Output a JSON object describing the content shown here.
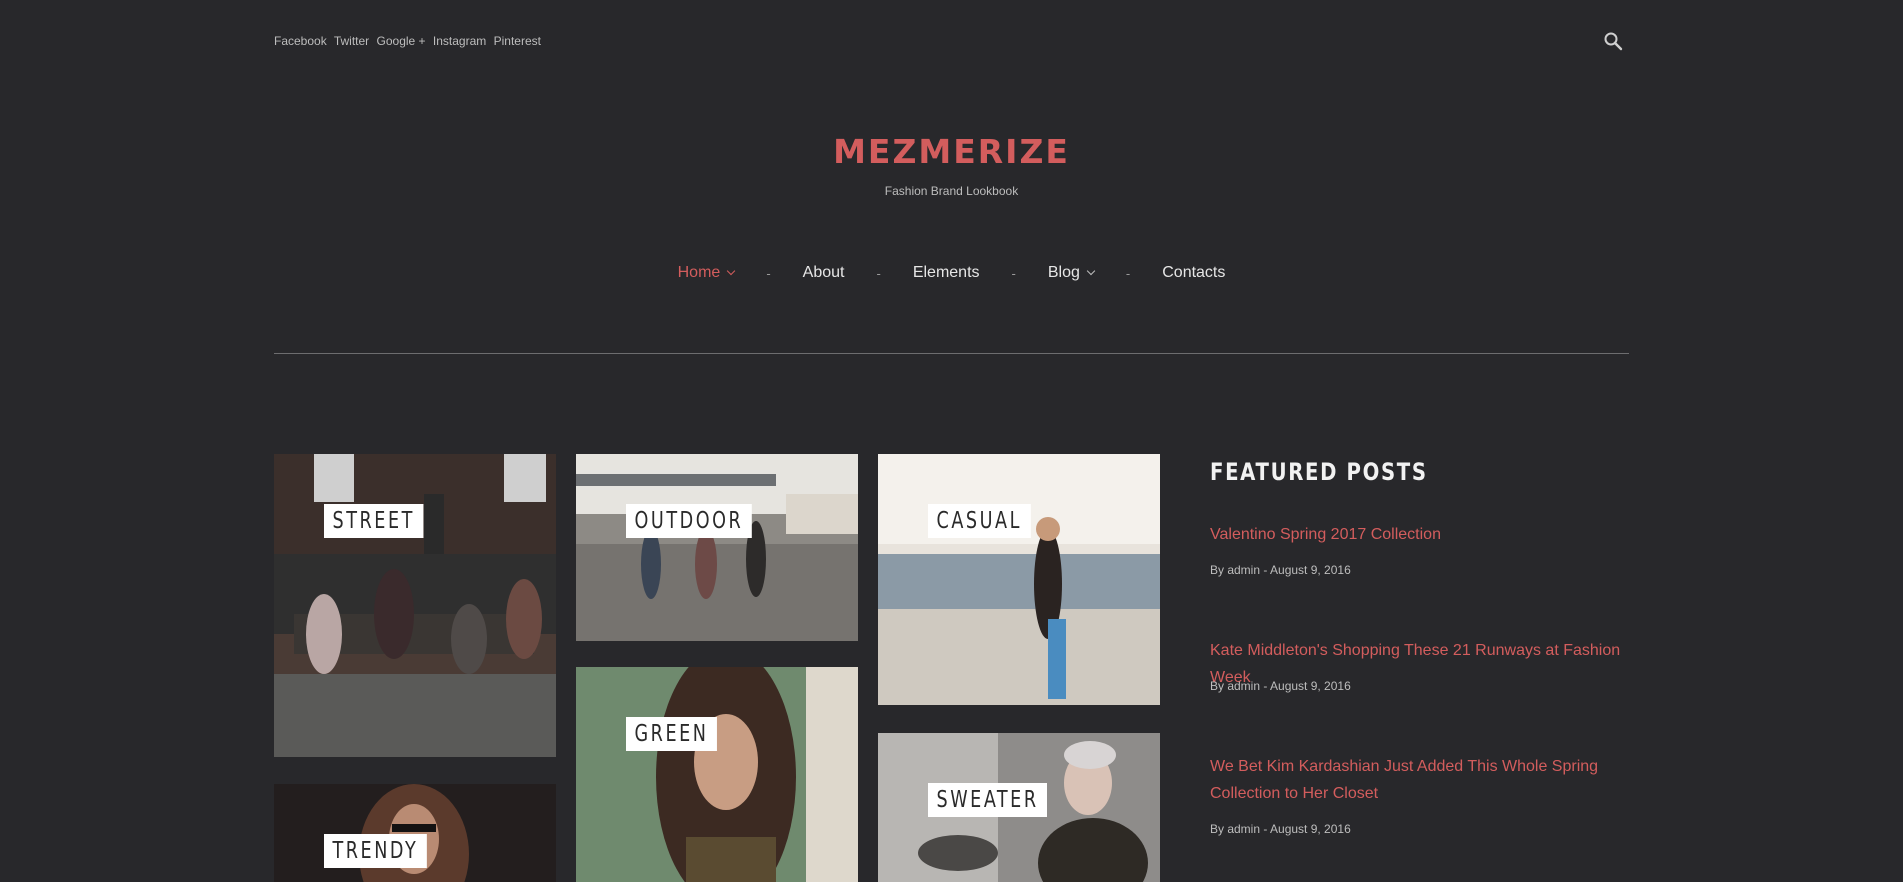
{
  "header": {
    "social_links": [
      "Facebook",
      "Twitter",
      "Google +",
      "Instagram",
      "Pinterest"
    ]
  },
  "brand": {
    "name": "MEZMERIZE",
    "tagline": "Fashion Brand Lookbook",
    "accent_color": "#d35d5d"
  },
  "nav": {
    "items": [
      {
        "label": "Home",
        "has_dropdown": true,
        "active": true
      },
      {
        "label": "About",
        "has_dropdown": false,
        "active": false
      },
      {
        "label": "Elements",
        "has_dropdown": false,
        "active": false
      },
      {
        "label": "Blog",
        "has_dropdown": true,
        "active": false
      },
      {
        "label": "Contacts",
        "has_dropdown": false,
        "active": false
      }
    ],
    "separator": "-"
  },
  "categories": [
    {
      "label": "STREET"
    },
    {
      "label": "OUTDOOR"
    },
    {
      "label": "CASUAL"
    },
    {
      "label": "GREEN"
    },
    {
      "label": "SWEATER"
    },
    {
      "label": "TRENDY"
    }
  ],
  "sidebar": {
    "title": "FEATURED POSTS",
    "posts": [
      {
        "title": "Valentino Spring 2017 Collection",
        "meta": "By admin - August 9, 2016"
      },
      {
        "title": "Kate Middleton's Shopping These 21 Runways at Fashion Week",
        "meta": "By admin - August 9, 2016"
      },
      {
        "title": "We Bet Kim Kardashian Just Added This Whole Spring Collection to Her Closet",
        "meta": "By admin - August 9, 2016"
      }
    ]
  }
}
